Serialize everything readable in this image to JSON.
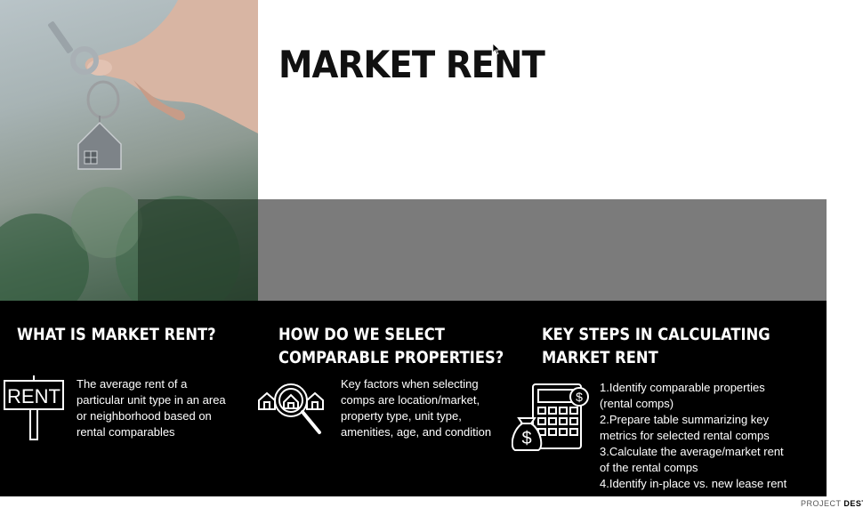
{
  "slide": {
    "title": "MARKET RENT"
  },
  "columns": [
    {
      "heading_lines": [
        "WHAT IS MARKET RENT?"
      ],
      "icon_sign_text": "RENT",
      "body_lines": [
        "The average rent of a",
        "particular unit type in an area",
        "or neighborhood based on",
        "rental comparables"
      ]
    },
    {
      "heading_lines": [
        "HOW DO WE SELECT",
        "COMPARABLE PROPERTIES?"
      ],
      "body_lines": [
        "Key factors when selecting",
        "comps are location/market,",
        "property type, unit type,",
        "amenities, age, and condition"
      ]
    },
    {
      "heading_lines": [
        "KEY STEPS IN CALCULATING",
        "MARKET RENT"
      ],
      "body_lines": [
        "1.Identify comparable properties",
        "(rental comps)",
        "2.Prepare table summarizing key",
        "metrics for selected rental comps",
        "3.Calculate the average/market rent",
        "of the rental comps",
        "4.Identify in-place vs. new lease rent"
      ]
    }
  ],
  "footer": {
    "prefix": "PROJECT ",
    "brand": "DESTIN"
  },
  "icons": {
    "photo": "hand-holding-house-key",
    "col1": "rent-sign-icon",
    "col2": "house-search-icon",
    "col3": "calculator-money-bag-icon"
  },
  "colors": {
    "panel": "#000000",
    "band": "#7b7b7b",
    "text_on_dark": "#ffffff",
    "title": "#111111"
  }
}
